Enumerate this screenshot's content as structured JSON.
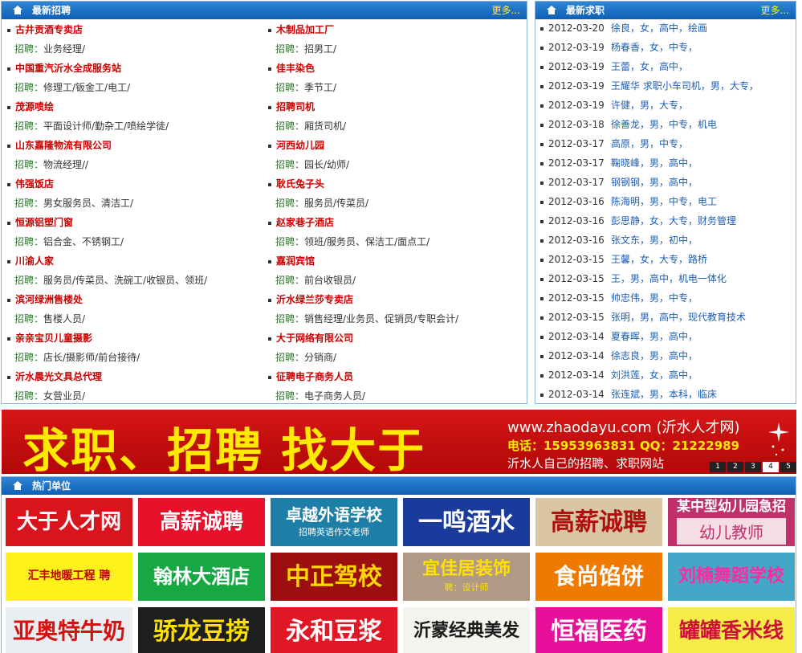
{
  "jobs": {
    "title": "最新招聘",
    "more": "更多...",
    "label": "招聘：",
    "left": [
      {
        "company": "古井贡酒专卖店",
        "positions": "业务经理/"
      },
      {
        "company": "中国重汽沂水全成服务站",
        "positions": "修理工/钣金工/电工/"
      },
      {
        "company": "茂源喷绘",
        "positions": "平面设计师/勤杂工/喷绘学徒/"
      },
      {
        "company": "山东嘉隆物流有限公司",
        "positions": "物流经理//"
      },
      {
        "company": "伟强饭店",
        "positions": "男女服务员、清洁工/"
      },
      {
        "company": "恒源铝塑门窗",
        "positions": "铝合金、不锈钢工/"
      },
      {
        "company": "川渝人家",
        "positions": "服务员/传菜员、洗碗工/收银员、领班/"
      },
      {
        "company": "滨河绿洲售楼处",
        "positions": "售楼人员/"
      },
      {
        "company": "亲亲宝贝儿童摄影",
        "positions": "店长/摄影师/前台接待/"
      },
      {
        "company": "沂水晨光文具总代理",
        "positions": "女营业员/"
      }
    ],
    "right": [
      {
        "company": "木制品加工厂",
        "positions": "招男工/"
      },
      {
        "company": "佳丰染色",
        "positions": "季节工/"
      },
      {
        "company": "招聘司机",
        "positions": "厢货司机/"
      },
      {
        "company": "河西幼儿园",
        "positions": "园长/幼师/"
      },
      {
        "company": "耿氏兔子头",
        "positions": "服务员/传菜员/"
      },
      {
        "company": "赵家巷子酒店",
        "positions": "领班/服务员、保洁工/面点工/"
      },
      {
        "company": "嘉润宾馆",
        "positions": "前台收银员/"
      },
      {
        "company": "沂水绿兰莎专卖店",
        "positions": "销售经理/业务员、促销员/专职会计/"
      },
      {
        "company": "大于网络有限公司",
        "positions": "分销商/"
      },
      {
        "company": "征聘电子商务人员",
        "positions": "电子商务人员/"
      }
    ]
  },
  "seekers": {
    "title": "最新求职",
    "more": "更多...",
    "rows": [
      {
        "date": "2012-03-20",
        "info": "徐良，女，高中，绘画"
      },
      {
        "date": "2012-03-19",
        "info": "杨春香，女，中专，"
      },
      {
        "date": "2012-03-19",
        "info": "王蕾，女，高中，"
      },
      {
        "date": "2012-03-19",
        "info": "王耀华 求职小车司机，男，大专，"
      },
      {
        "date": "2012-03-19",
        "info": "许健，男，大专，"
      },
      {
        "date": "2012-03-18",
        "info": "徐善龙，男，中专，机电"
      },
      {
        "date": "2012-03-17",
        "info": "高原，男，中专，"
      },
      {
        "date": "2012-03-17",
        "info": "鞠晓峰，男，高中，"
      },
      {
        "date": "2012-03-17",
        "info": "钢钢钢，男，高中，"
      },
      {
        "date": "2012-03-16",
        "info": "陈海明，男，中专，电工"
      },
      {
        "date": "2012-03-16",
        "info": "彭思静，女，大专，财务管理"
      },
      {
        "date": "2012-03-16",
        "info": "张文东，男，初中，"
      },
      {
        "date": "2012-03-15",
        "info": "王馨，女，大专，路桥"
      },
      {
        "date": "2012-03-15",
        "info": "王，男，高中，机电一体化"
      },
      {
        "date": "2012-03-15",
        "info": "帅忠伟，男，中专，"
      },
      {
        "date": "2012-03-15",
        "info": "张明，男，高中，现代教育技术"
      },
      {
        "date": "2012-03-14",
        "info": "夏春晖，男，高中，"
      },
      {
        "date": "2012-03-14",
        "info": "徐志良，男，高中，"
      },
      {
        "date": "2012-03-14",
        "info": "刘洪莲，女，高中，"
      },
      {
        "date": "2012-03-14",
        "info": "张连斌，男，本科，临床"
      }
    ]
  },
  "banner": {
    "headline": "求职、招聘 找大于",
    "url": "www.zhaodayu.com (沂水人才网)",
    "contact": "电话：15953963831  QQ：21222989",
    "slogan": "沂水人自己的招聘、求职网站",
    "pages": [
      "1",
      "2",
      "3",
      "4",
      "5"
    ]
  },
  "hot": {
    "title": "热门单位",
    "tiles": [
      {
        "text": "大于人才网",
        "sub": "",
        "bg": "#d8141c",
        "fg": "#ffffff"
      },
      {
        "text": "高薪诚聘",
        "sub": "",
        "bg": "#e8102a",
        "fg": "#ffffff"
      },
      {
        "text": "卓越外语学校",
        "sub": "招聘英语作文老师",
        "bg": "#1d7fa8",
        "fg": "#ffffff"
      },
      {
        "text": "一鸣酒水",
        "sub": "",
        "bg": "#1a3a9c",
        "fg": "#ffffff"
      },
      {
        "text": "高薪诚聘",
        "sub": "",
        "bg": "#d9c6a4",
        "fg": "#b01010"
      },
      {
        "text": "某中型幼儿园急招",
        "sub": "幼儿教师",
        "bg": "#c0306a",
        "fg": "#ffffff"
      },
      {
        "text": "汇丰地暖工程 聘",
        "sub": "",
        "bg": "#fff21a",
        "fg": "#c00000"
      },
      {
        "text": "翰林大酒店",
        "sub": "",
        "bg": "#17a844",
        "fg": "#ffffff"
      },
      {
        "text": "中正驾校",
        "sub": "",
        "bg": "#9c0e10",
        "fg": "#ffd800"
      },
      {
        "text": "宜佳居装饰",
        "sub": "聘：设计师",
        "bg": "#b09a86",
        "fg": "#ffe000"
      },
      {
        "text": "食尚馅饼",
        "sub": "",
        "bg": "#f07a00",
        "fg": "#ffffff"
      },
      {
        "text": "刘楠舞蹈学校",
        "sub": "",
        "bg": "#43a8c8",
        "fg": "#ff2aa0"
      },
      {
        "text": "亚奥特牛奶",
        "sub": "",
        "bg": "#e8eef2",
        "fg": "#d81010"
      },
      {
        "text": "骄龙豆捞",
        "sub": "",
        "bg": "#1e1e1e",
        "fg": "#ffe000"
      },
      {
        "text": "永和豆浆",
        "sub": "",
        "bg": "#e01826",
        "fg": "#ffffff"
      },
      {
        "text": "沂蒙经典美发",
        "sub": "",
        "bg": "#f4f4ee",
        "fg": "#1a1a1a"
      },
      {
        "text": "恒福医药",
        "sub": "",
        "bg": "#e8109a",
        "fg": "#ffffff"
      },
      {
        "text": "罐罐香米线",
        "sub": "",
        "bg": "#f5ec4a",
        "fg": "#d0103a"
      }
    ]
  }
}
